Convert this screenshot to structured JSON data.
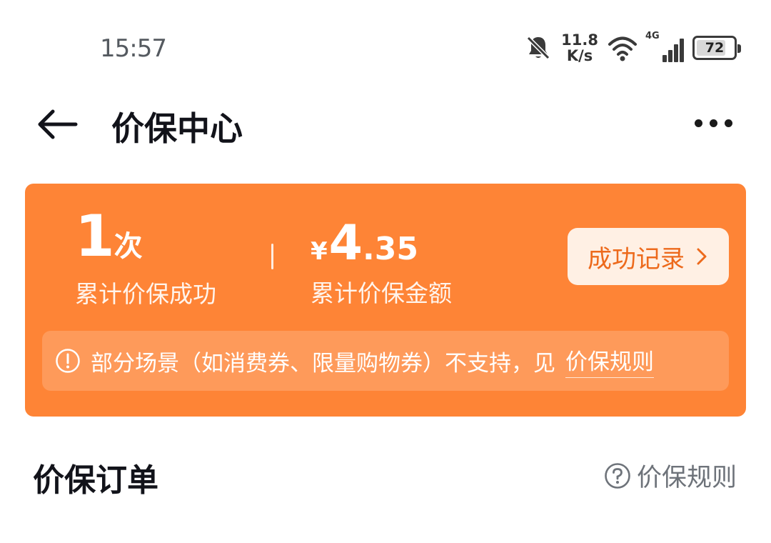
{
  "status_bar": {
    "time": "15:57",
    "net_speed_value": "11.8",
    "net_speed_unit": "K/s",
    "network_type": "4G",
    "battery_level": "72",
    "icons": [
      "bell-muted-icon",
      "wifi-icon",
      "signal-icon",
      "battery-icon"
    ]
  },
  "header": {
    "title": "价保中心",
    "back_icon": "arrow-left-icon",
    "more_icon": "more-dots-icon"
  },
  "summary_card": {
    "success_count": "1",
    "success_unit": "次",
    "success_label": "累计价保成功",
    "currency_symbol": "¥",
    "amount_integer": "4",
    "amount_decimal": ".35",
    "amount_label": "累计价保金额",
    "record_button_label": "成功记录",
    "notice_text": "部分场景（如消费券、限量购物券）不支持，见",
    "notice_link": "价保规则",
    "accent_color": "#fe8436"
  },
  "orders_section": {
    "title": "价保订单",
    "rules_label": "价保规则"
  }
}
